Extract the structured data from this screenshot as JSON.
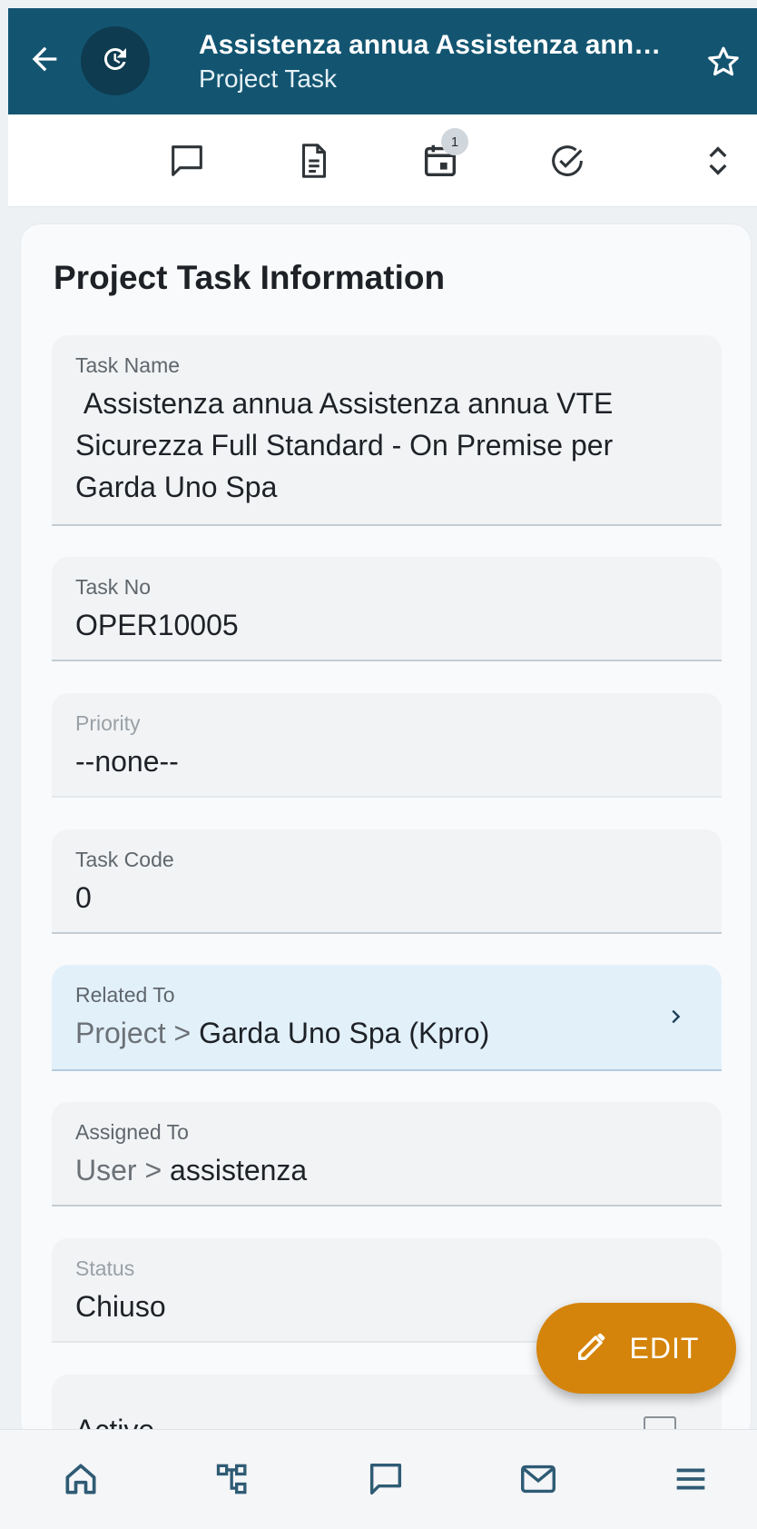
{
  "header": {
    "title": "Assistenza annua Assistenza annu...",
    "subtitle": "Project Task",
    "icons": {
      "back": "arrow-left-icon",
      "avatar": "refresh-clock-icon",
      "favorite": "star-outline-icon"
    }
  },
  "toolbar": {
    "items": [
      {
        "name": "comments",
        "icon": "chat-bubble-icon"
      },
      {
        "name": "documents",
        "icon": "document-icon"
      },
      {
        "name": "calendar",
        "icon": "calendar-icon",
        "badge": "1"
      },
      {
        "name": "tasks",
        "icon": "check-circle-icon"
      },
      {
        "name": "expand",
        "icon": "unfold-icon"
      }
    ]
  },
  "card": {
    "title": "Project Task Information",
    "fields": {
      "task_name": {
        "label": "Task Name",
        "value": " Assistenza annua Assistenza annua VTE Sicurezza Full Standard - On Premise per Garda Uno Spa"
      },
      "task_no": {
        "label": "Task No",
        "value": "OPER10005"
      },
      "priority": {
        "label": "Priority",
        "value": "--none--"
      },
      "task_code": {
        "label": "Task Code",
        "value": "0"
      },
      "related_to": {
        "label": "Related To",
        "module": "Project > ",
        "value": "Garda Uno Spa (Kpro)"
      },
      "assigned_to": {
        "label": "Assigned To",
        "module": "User > ",
        "value": "assistenza"
      },
      "status": {
        "label": "Status",
        "value": "Chiuso"
      },
      "active": {
        "label": "Active",
        "checked": false
      }
    }
  },
  "fab": {
    "label": "EDIT",
    "icon": "pencil-icon"
  },
  "bottom_nav": {
    "items": [
      {
        "name": "home",
        "icon": "home-icon"
      },
      {
        "name": "hierarchy",
        "icon": "org-chart-icon"
      },
      {
        "name": "chat",
        "icon": "chat-bubble-icon"
      },
      {
        "name": "mail",
        "icon": "mail-icon"
      },
      {
        "name": "menu",
        "icon": "hamburger-menu-icon"
      }
    ]
  },
  "colors": {
    "header": "#135571",
    "accent": "#d4840a",
    "link_field": "#e2f0fa"
  }
}
